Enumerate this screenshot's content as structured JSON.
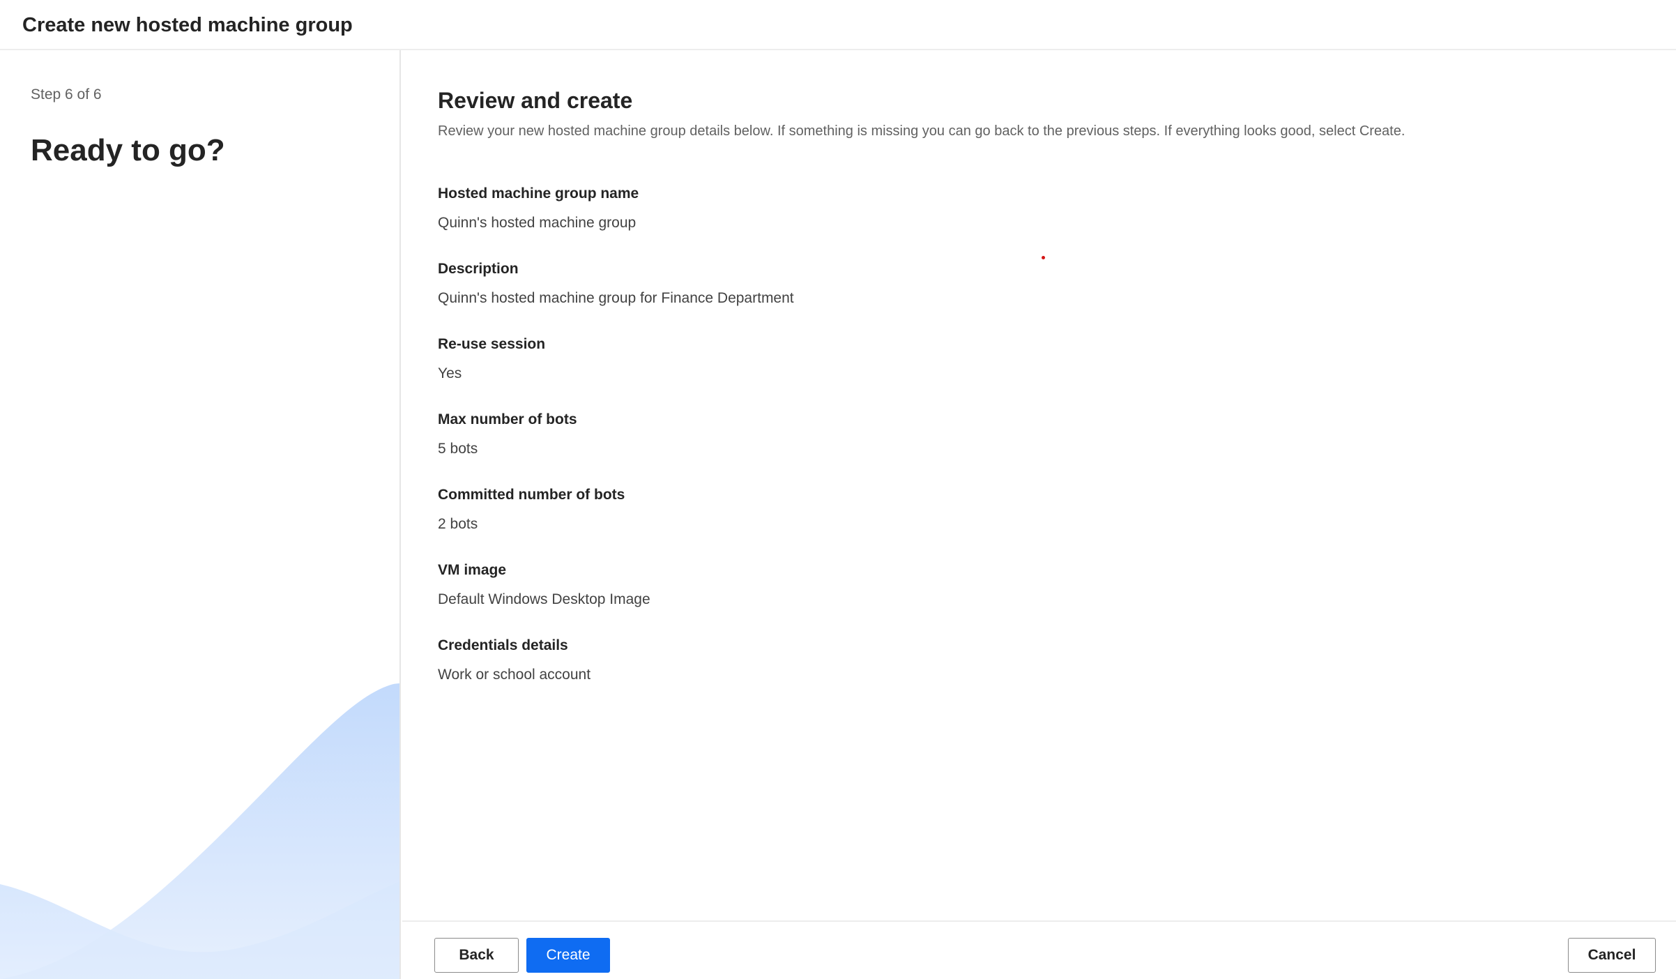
{
  "header": {
    "title": "Create new hosted machine group"
  },
  "left_panel": {
    "step_label": "Step 6 of 6",
    "title": "Ready to go?"
  },
  "main": {
    "title": "Review and create",
    "description": "Review your new hosted machine group details below. If something is missing you can go back to the previous steps. If everything looks good, select Create.",
    "fields": [
      {
        "label": "Hosted machine group name",
        "value": "Quinn's hosted machine group"
      },
      {
        "label": "Description",
        "value": "Quinn's hosted machine group for Finance Department"
      },
      {
        "label": "Re-use session",
        "value": "Yes"
      },
      {
        "label": "Max number of bots",
        "value": "5 bots"
      },
      {
        "label": "Committed number of bots",
        "value": "2 bots"
      },
      {
        "label": "VM image",
        "value": "Default Windows Desktop Image"
      },
      {
        "label": "Credentials details",
        "value": "Work or school account"
      }
    ]
  },
  "footer": {
    "back_label": "Back",
    "create_label": "Create",
    "cancel_label": "Cancel"
  },
  "colors": {
    "primary": "#0f6cf2",
    "wave_light": "#c4dbfd",
    "wave_lighter": "#dbe9fd"
  }
}
